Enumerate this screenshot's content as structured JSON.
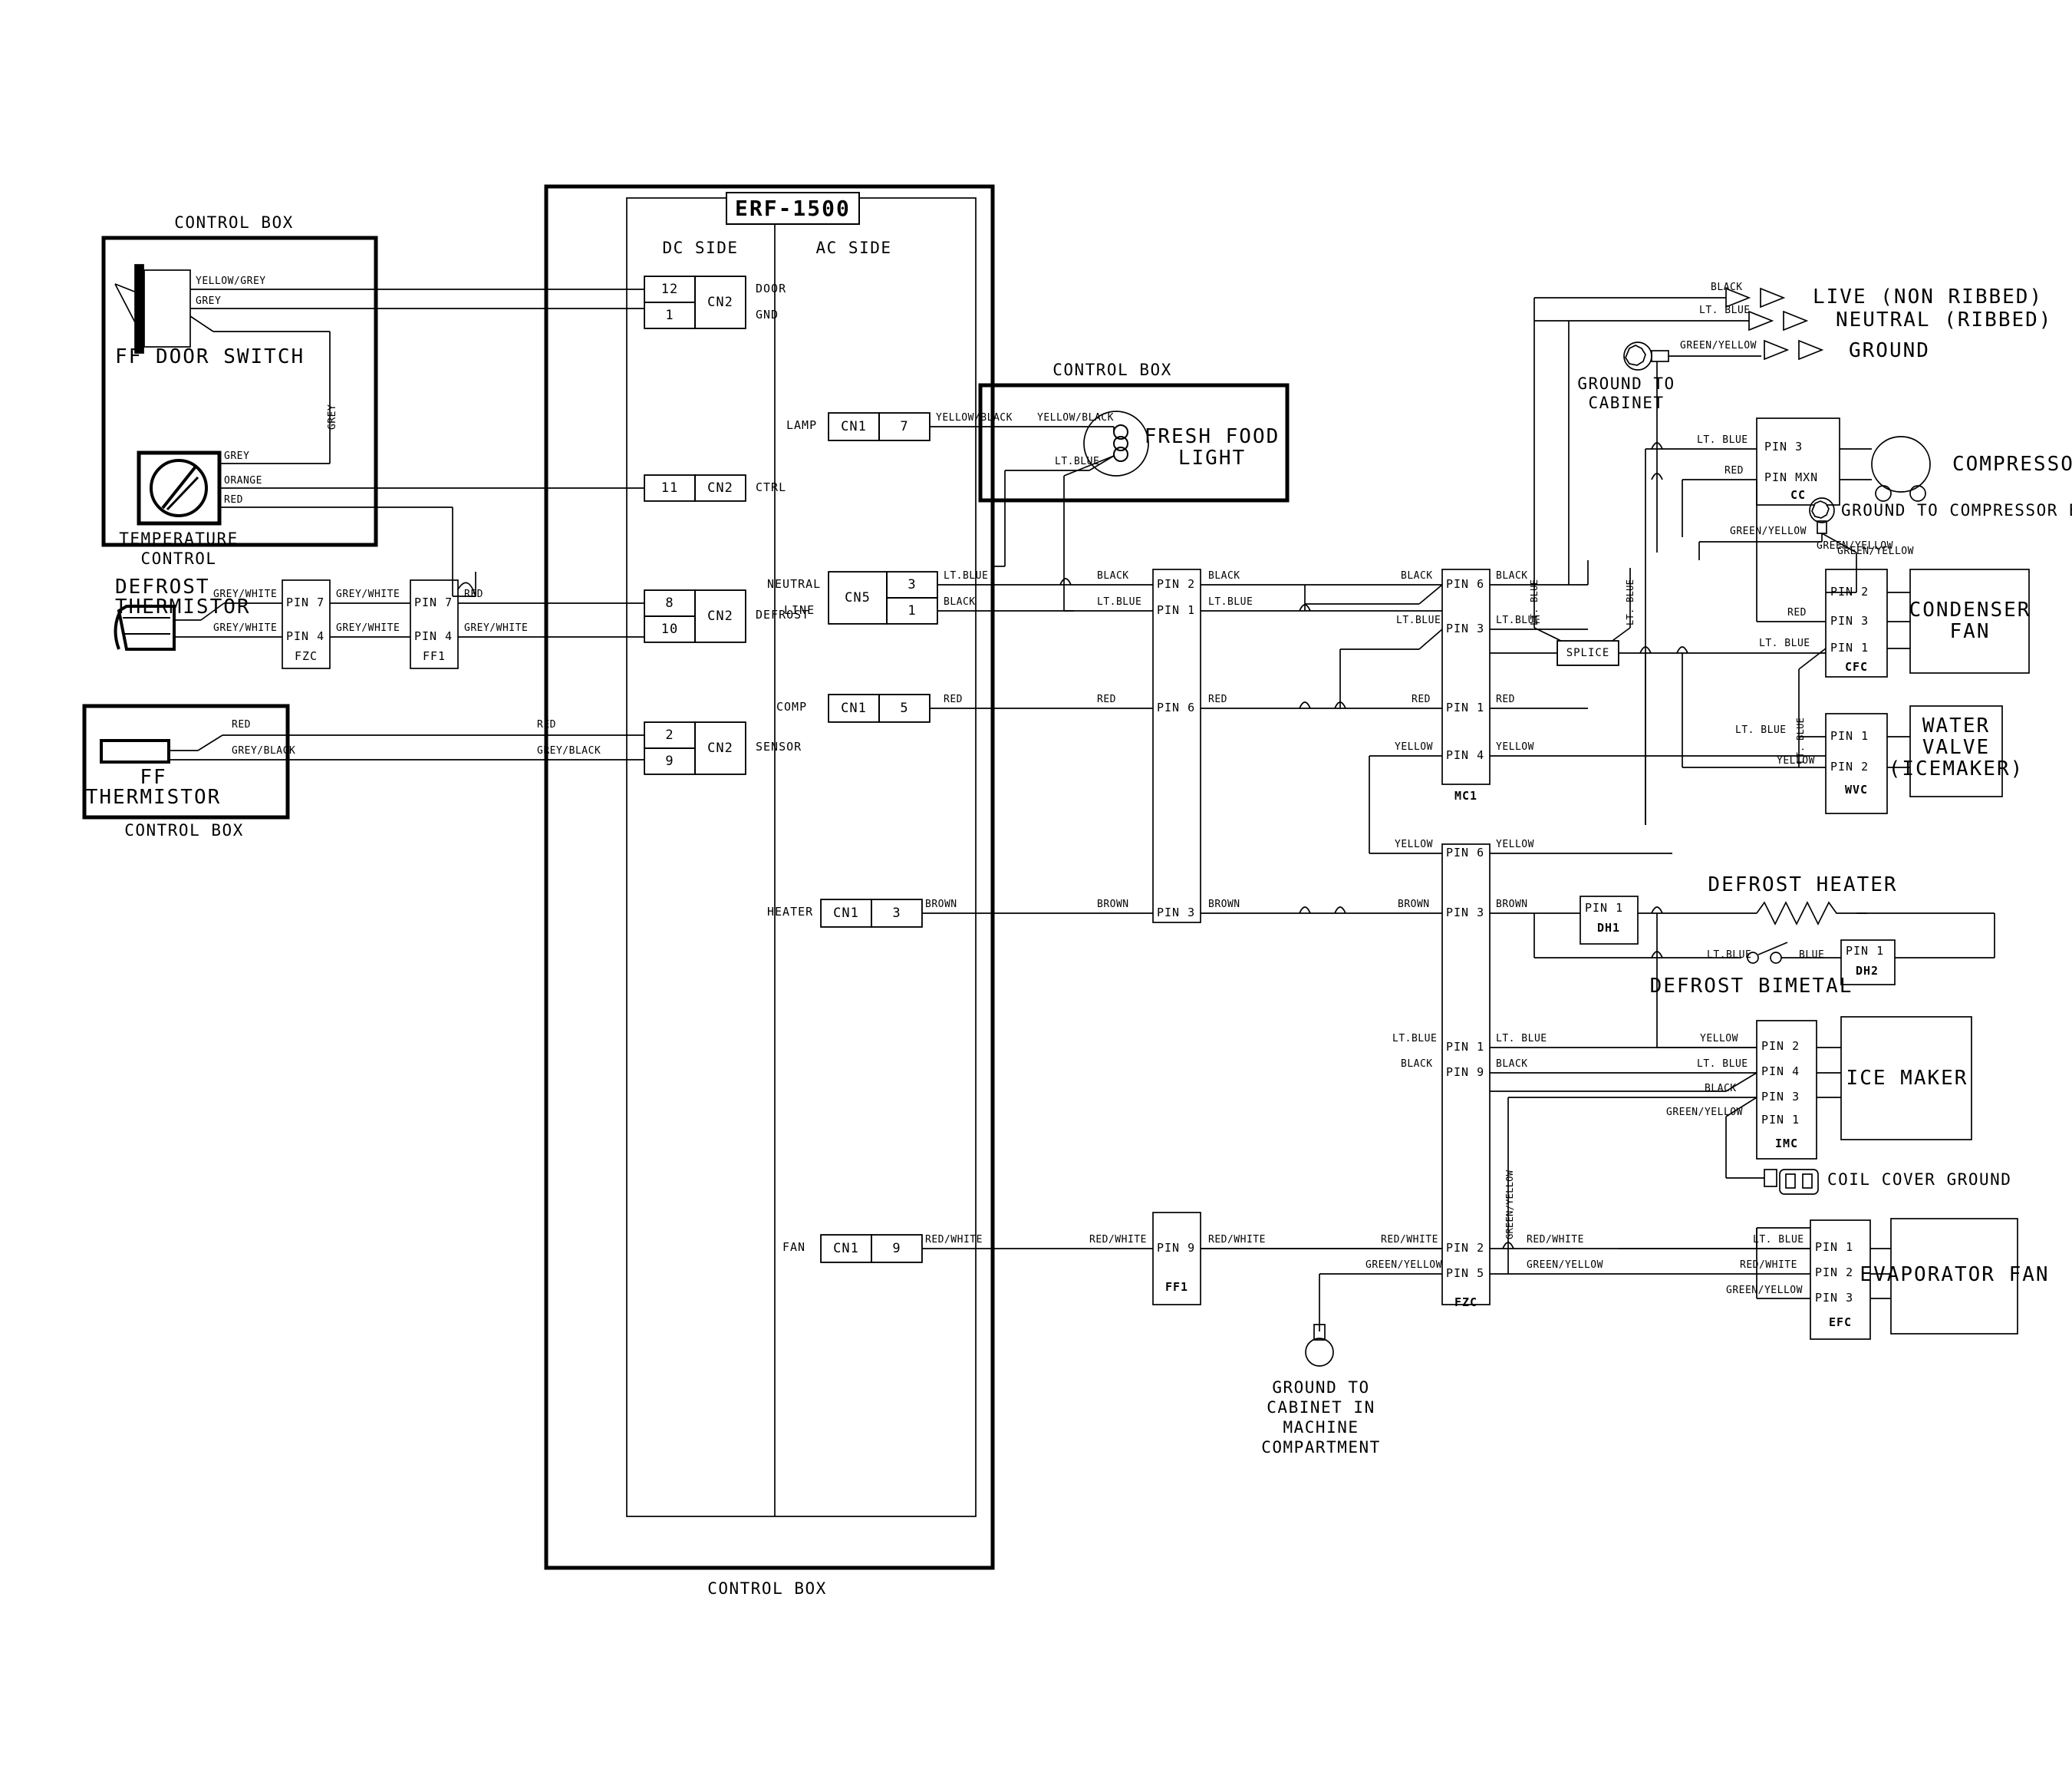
{
  "sheet": {
    "title": "ERF-1500",
    "side_labels": {
      "dc": "DC SIDE",
      "ac": "AC SIDE"
    },
    "control_box": "CONTROL BOX"
  },
  "left_control_box": {
    "caption": "CONTROL BOX",
    "door_switch": "FF DOOR SWITCH",
    "door_switch_wires": [
      "YELLOW/GREY",
      "GREY"
    ],
    "grey_drop": "GREY",
    "temp_control": "TEMPERATURE\nCONTROL",
    "temp_control_line1": "TEMPERATURE",
    "temp_control_line2": "CONTROL",
    "temp_wires": [
      "GREY",
      "ORANGE",
      "RED"
    ]
  },
  "defrost_thermistor": {
    "name_line1": "DEFROST",
    "name_line2": "THERMISTOR",
    "wire_top": "GREY/WHITE",
    "wire_bottom": "GREY/WHITE",
    "fzc": {
      "name": "FZC",
      "pins": [
        "PIN 7",
        "PIN 4"
      ]
    },
    "ff1": {
      "name": "FF1",
      "pins": [
        "PIN 7",
        "PIN 4"
      ]
    },
    "mid_top": "GREY/WHITE",
    "mid_bottom": "GREY/WHITE",
    "out_top": "RED",
    "out_bottom": "GREY/WHITE"
  },
  "ff_thermistor": {
    "name_line1": "FF",
    "name_line2": "THERMISTOR",
    "caption": "CONTROL BOX",
    "wire_top": "RED",
    "wire_bottom": "GREY/BLACK",
    "out_top": "RED",
    "out_bottom": "GREY/BLACK"
  },
  "erf1500_dc": [
    {
      "name": "door-gnd",
      "pin_top": "12",
      "pin_bottom": "1",
      "conn": "CN2",
      "label_top": "DOOR",
      "label_bottom": "GND",
      "wire_top": "YELLOW/GREY",
      "wire_bottom": "GREY"
    },
    {
      "name": "ctrl",
      "pin_top": "11",
      "conn": "CN2",
      "label_top": "CTRL",
      "wire_top": "ORANGE"
    },
    {
      "name": "defrost",
      "pin_top": "8",
      "pin_bottom": "10",
      "conn": "CN2",
      "label_top": "DEFROST",
      "wire_top": "RED",
      "wire_bottom": "GREY/WHITE"
    },
    {
      "name": "sensor",
      "pin_top": "2",
      "pin_bottom": "9",
      "conn": "CN2",
      "label_top": "SENSOR",
      "wire_top": "RED",
      "wire_bottom": "GREY/BLACK"
    }
  ],
  "erf1500_ac": [
    {
      "name": "lamp",
      "prefix": "LAMP",
      "conn": "CN1",
      "pin": "7",
      "wire": "YELLOW/BLACK"
    },
    {
      "name": "neutral-line",
      "prefix_top": "NEUTRAL",
      "prefix_bottom": "LINE",
      "conn": "CN5",
      "pin_top": "3",
      "pin_bottom": "1",
      "wire_top": "LT.BLUE",
      "wire_bottom": "BLACK"
    },
    {
      "name": "comp",
      "prefix": "COMP",
      "conn": "CN1",
      "pin": "5",
      "wire": "RED"
    },
    {
      "name": "heater",
      "prefix": "HEATER",
      "conn": "CN1",
      "pin": "3",
      "wire": "BROWN"
    },
    {
      "name": "fan",
      "prefix": "FAN",
      "conn": "CN1",
      "pin": "9",
      "wire": "RED/WHITE"
    }
  ],
  "fresh_food_light": {
    "caption": "CONTROL BOX",
    "name_line1": "FRESH FOOD",
    "name_line2": "LIGHT",
    "wire_top": "YELLOW/BLACK",
    "wire_bottom": "LT.BLUE"
  },
  "ff1_main": {
    "name": "FF1",
    "rows": [
      {
        "pin": "PIN 2",
        "left": "BLACK",
        "right": "BLACK"
      },
      {
        "pin": "PIN 1",
        "left": "LT.BLUE",
        "right": "LT.BLUE"
      },
      {
        "pin": "PIN 6",
        "left": "RED",
        "right": "RED"
      },
      {
        "pin": "PIN 3",
        "left": "BROWN",
        "right": "BROWN"
      },
      {
        "pin": "PIN 9",
        "left": "RED/WHITE",
        "right": "RED/WHITE"
      }
    ]
  },
  "mc1": {
    "name": "MC1",
    "rows": [
      {
        "pin": "PIN 6",
        "left": "BLACK",
        "right": "BLACK"
      },
      {
        "pin": "PIN 3",
        "left": "LT.BLUE",
        "right": "LT.BLUE"
      },
      {
        "pin": "PIN 1",
        "left": "RED",
        "right": "RED"
      },
      {
        "pin": "PIN 4",
        "left": "YELLOW",
        "right": "YELLOW"
      }
    ]
  },
  "fzc_mid": {
    "name": "FZC",
    "rows": [
      {
        "pin": "PIN 6",
        "left": "YELLOW",
        "right": "YELLOW"
      },
      {
        "pin": "PIN 3",
        "left": "BROWN",
        "right": "BROWN"
      },
      {
        "pin": "PIN 1",
        "left": "LT.BLUE",
        "right": "LT. BLUE"
      },
      {
        "pin": "PIN 9",
        "left": "BLACK",
        "right": "BLACK"
      },
      {
        "pin": "PIN 2",
        "left": "RED/WHITE",
        "right": "RED/WHITE"
      },
      {
        "pin": "PIN 5",
        "left": "GREEN/YELLOW",
        "right": "GREEN/YELLOW"
      }
    ],
    "vertical_wire": "GREEN/YELLOW"
  },
  "power": {
    "live": "LIVE (NON RIBBED)",
    "neutral": "NEUTRAL (RIBBED)",
    "ground": "GROUND",
    "live_wire": "BLACK",
    "neutral_wire": "LT. BLUE",
    "ground_wire": "GREEN/YELLOW",
    "ground_to_cabinet_1": "GROUND TO",
    "ground_to_cabinet_2": "CABINET"
  },
  "compressor": {
    "name": "COMPRESSOR",
    "conn": "CC",
    "pin_top": "PIN 3",
    "pin_bottom": "PIN MXN",
    "wire_top": "LT. BLUE",
    "wire_bottom": "RED",
    "ground_note": "GROUND TO COMPRESSOR BASE",
    "ground_wire_1": "GREEN/YELLOW",
    "ground_wire_2": "GREEN/YELLOW"
  },
  "splice": {
    "label": "SPLICE",
    "wire_left": "LT.BLUE",
    "wire_v1": "LT. BLUE",
    "wire_v2": "LT. BLUE"
  },
  "condenser_fan": {
    "name_line1": "CONDENSER",
    "name_line2": "FAN",
    "conn": "CFC",
    "pins": [
      "PIN 2",
      "PIN 3",
      "PIN 1"
    ],
    "wires": [
      "GREEN/YELLOW",
      "RED",
      "LT. BLUE"
    ],
    "vertical_wire": "LT. BLUE"
  },
  "water_valve": {
    "name_line1": "WATER",
    "name_line2": "VALVE",
    "name_line3": "(ICEMAKER)",
    "conn": "WVC",
    "pins": [
      "PIN 1",
      "PIN 2"
    ],
    "wires": [
      "LT. BLUE",
      "YELLOW"
    ]
  },
  "defrost_heater": {
    "name": "DEFROST HEATER",
    "dh1": {
      "pin": "PIN 1",
      "name": "DH1"
    },
    "dh2": {
      "pin": "PIN 1",
      "name": "DH2"
    },
    "bimetal": "DEFROST BIMETAL",
    "bimetal_wire_left": "LT.BLUE",
    "bimetal_wire_right": "BLUE"
  },
  "ice_maker": {
    "name": "ICE MAKER",
    "conn": "IMC",
    "pins": [
      "PIN 2",
      "PIN 4",
      "PIN 3",
      "PIN 1"
    ],
    "wires": [
      "YELLOW",
      "LT. BLUE",
      "BLACK",
      "GREEN/YELLOW"
    ]
  },
  "coil_cover_ground": {
    "label": "COIL COVER GROUND"
  },
  "evaporator_fan": {
    "name": "EVAPORATOR FAN",
    "conn": "EFC",
    "pins": [
      "PIN 1",
      "PIN 2",
      "PIN 3"
    ],
    "wires": [
      "LT. BLUE",
      "RED/WHITE",
      "GREEN/YELLOW"
    ]
  },
  "ground_machine": {
    "l1": "GROUND TO",
    "l2": "CABINET IN",
    "l3": "MACHINE",
    "l4": "COMPARTMENT"
  }
}
